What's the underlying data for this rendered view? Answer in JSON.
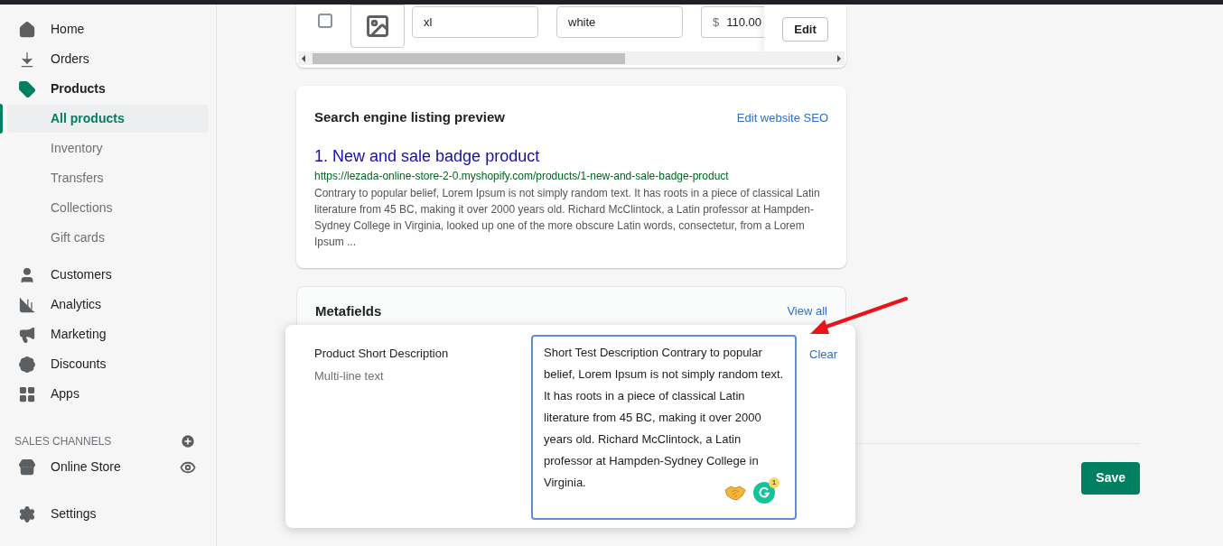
{
  "sidebar": {
    "items": [
      {
        "label": "Home",
        "selected": false
      },
      {
        "label": "Orders",
        "selected": false
      },
      {
        "label": "Products",
        "selected": true,
        "children": [
          {
            "label": "All products",
            "selected": true
          },
          {
            "label": "Inventory",
            "selected": false
          },
          {
            "label": "Transfers",
            "selected": false
          },
          {
            "label": "Collections",
            "selected": false
          },
          {
            "label": "Gift cards",
            "selected": false
          }
        ]
      },
      {
        "label": "Customers",
        "selected": false
      },
      {
        "label": "Analytics",
        "selected": false
      },
      {
        "label": "Marketing",
        "selected": false
      },
      {
        "label": "Discounts",
        "selected": false
      },
      {
        "label": "Apps",
        "selected": false
      }
    ],
    "sales_channels": {
      "heading": "SALES CHANNELS",
      "items": [
        {
          "label": "Online Store",
          "selected": false
        }
      ]
    },
    "settings": {
      "label": "Settings",
      "selected": false
    }
  },
  "variant_row": {
    "checked": false,
    "size": "xl",
    "option_value": "white",
    "currency": "$",
    "price": "110.00",
    "edit": "Edit"
  },
  "seo": {
    "title": "Search engine listing preview",
    "link": "Edit website SEO",
    "result_title": "1. New and sale badge product",
    "url": "https://lezada-online-store-2-0.myshopify.com/products/1-new-and-sale-badge-product",
    "description": "Contrary to popular belief, Lorem Ipsum is not simply random text. It has roots in a piece of classical Latin literature from 45 BC, making it over 2000 years old. Richard McClintock, a Latin professor at Hampden-Sydney College in Virginia, looked up one of the more obscure Latin words, consectetur, from a Lorem Ipsum ..."
  },
  "metafields": {
    "title": "Metafields",
    "link": "View all",
    "field": {
      "label": "Product Short Description",
      "type": "Multi-line text",
      "value": "Short Test Description Contrary to popular belief, Lorem Ipsum is not simply random text. It has roots in a piece of classical Latin literature from 45 BC, making it over 2000 years old. Richard McClintock, a Latin professor at Hampden-Sydney College in Virginia.",
      "clear": "Clear",
      "badge_count": "1"
    }
  },
  "save": "Save"
}
